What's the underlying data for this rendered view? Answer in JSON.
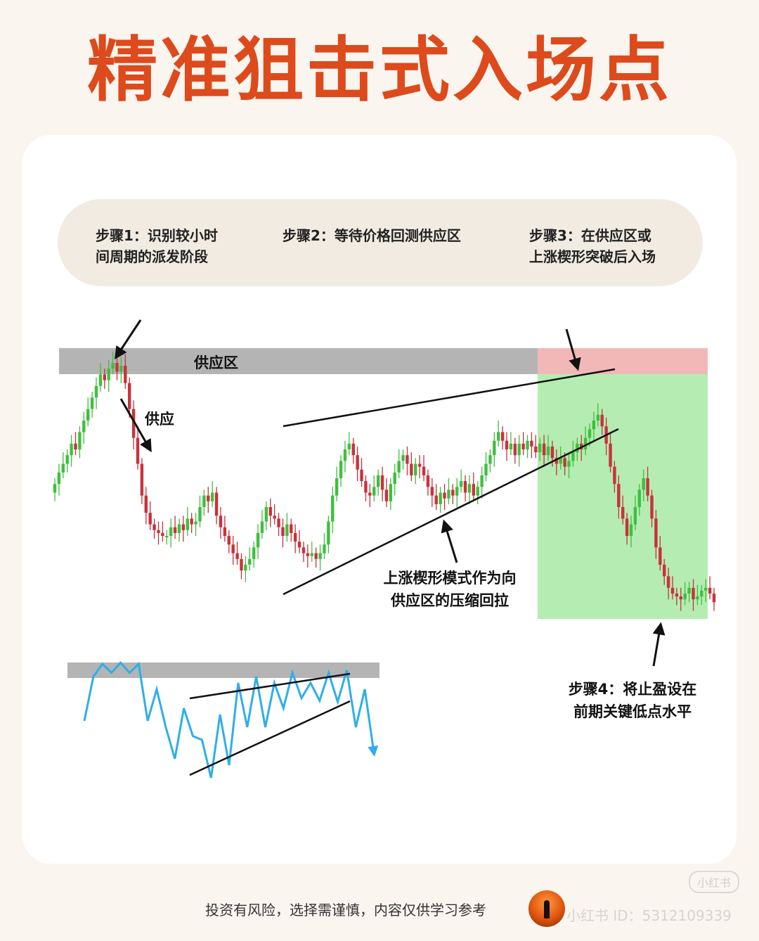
{
  "title": "精准狙击式入场点",
  "steps": [
    "步骤1：识别较小时\n间周期的派发阶段",
    "步骤2：等待价格回测供应区",
    "步骤3：在供应区或\n上涨楔形突破后入场"
  ],
  "annotations": {
    "supply_zone": "供应区",
    "supply": "供应",
    "wedge": "上涨楔形模式作为向\n供应区的压缩回拉",
    "step4": "步骤4：将止盈设在\n前期关键低点水平"
  },
  "footer": "投资有风险，选择需谨慎，内容仅供学习参考",
  "watermark": "小红书 ID：5312109339",
  "watermark_badge": "小红书",
  "colors": {
    "title": "#dd4a1c",
    "bull": "#3fbf3f",
    "bear": "#c8323c",
    "supply_zone": "#b4b4b4",
    "entry_zone": "#f2b8b8",
    "profit_zone": "#b5ecb2",
    "line_chart": "#2eaee8"
  },
  "chart_data": [
    {
      "type": "candlestick",
      "title": "",
      "xlabel": "",
      "ylabel": "",
      "grid": false,
      "close": [
        48,
        52,
        55,
        58,
        62,
        60,
        66,
        70,
        74,
        78,
        82,
        86,
        84,
        88,
        90,
        87,
        89,
        83,
        74,
        64,
        55,
        44,
        38,
        34,
        32,
        31,
        30,
        30,
        33,
        31,
        34,
        32,
        36,
        34,
        35,
        40,
        44,
        42,
        45,
        37,
        33,
        30,
        27,
        24,
        22,
        18,
        20,
        22,
        26,
        31,
        35,
        40,
        37,
        36,
        33,
        30,
        34,
        31,
        28,
        26,
        24,
        23,
        24,
        22,
        24,
        27,
        35,
        44,
        50,
        56,
        60,
        62,
        58,
        53,
        49,
        45,
        44,
        47,
        51,
        46,
        42,
        48,
        52,
        56,
        58,
        55,
        51,
        55,
        54,
        51,
        47,
        44,
        41,
        45,
        43,
        46,
        44,
        47,
        49,
        45,
        48,
        44,
        47,
        51,
        55,
        58,
        63,
        66,
        63,
        60,
        62,
        58,
        62,
        60,
        63,
        61,
        59,
        62,
        58,
        61,
        57,
        55,
        57,
        54,
        56,
        59,
        62,
        60,
        64,
        67,
        70,
        72,
        68,
        62,
        54,
        48,
        40,
        36,
        30,
        34,
        40,
        46,
        50,
        44,
        36,
        26,
        20,
        16,
        12,
        10,
        9,
        8,
        10,
        12,
        8,
        9,
        11,
        12,
        10,
        7
      ],
      "supply_zone": [
        80,
        86
      ],
      "wedge_upper": [
        [
          40,
          59
        ],
        [
          99,
          70
        ]
      ],
      "wedge_lower": [
        [
          40,
          21
        ],
        [
          100,
          63
        ]
      ]
    },
    {
      "type": "line",
      "title": "",
      "xlabel": "",
      "ylabel": "",
      "grid": false,
      "y": [
        50,
        85,
        95,
        88,
        96,
        88,
        95,
        50,
        75,
        45,
        20,
        60,
        38,
        35,
        5,
        55,
        15,
        80,
        45,
        85,
        45,
        80,
        60,
        88,
        68,
        80,
        66,
        88,
        65,
        90,
        45,
        75,
        25
      ],
      "supply_zone": [
        88,
        100
      ]
    }
  ]
}
